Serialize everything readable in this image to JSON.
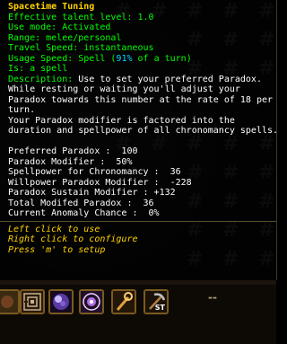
{
  "tooltip": {
    "title": "Spacetime Tuning",
    "talent_level": "Effective talent level: 1.0",
    "use_mode": "Use mode: Activated",
    "range": "Range: melee/personal",
    "travel_speed": "Travel Speed: instantaneous",
    "usage_speed_prefix": "Usage Speed: Spell (",
    "usage_speed_pct": "91%",
    "usage_speed_suffix": " of a turn)",
    "is": "Is: a spell",
    "description_label": "Description:",
    "description_lines": [
      " Use to set your preferred Paradox.",
      "While resting or waiting you'll adjust your",
      "Paradox towards this number at the rate of 18 per",
      "turn.",
      "Your Paradox modifier is factored into the",
      "duration and spellpower of all chronomancy spells."
    ],
    "stats": [
      "Preferred Paradox :  100",
      "Paradox Modifier :  50%",
      "Spellpower for Chronomancy :  36",
      "Willpower Paradox Modifier :  -228",
      "Paradox Sustain Modifier : +132",
      "Total Modifed Paradox :  36",
      "Current Anomaly Chance :  0%"
    ],
    "actions": [
      "Left click to use",
      "Right click to configure",
      "Press 'm' to setup"
    ]
  },
  "hotbar": {
    "slots": [
      {
        "icon": "maze-icon"
      },
      {
        "icon": "orb-icon"
      },
      {
        "icon": "rune-circle-icon"
      },
      {
        "icon": "staff-icon"
      },
      {
        "icon": "pickaxe-icon",
        "badge": "ST"
      }
    ],
    "empty_label": "--"
  },
  "colors": {
    "title": "#ffd200",
    "label": "#00ff00",
    "value": "#00d8ff",
    "text": "#ffffff",
    "action": "#ffd200"
  }
}
